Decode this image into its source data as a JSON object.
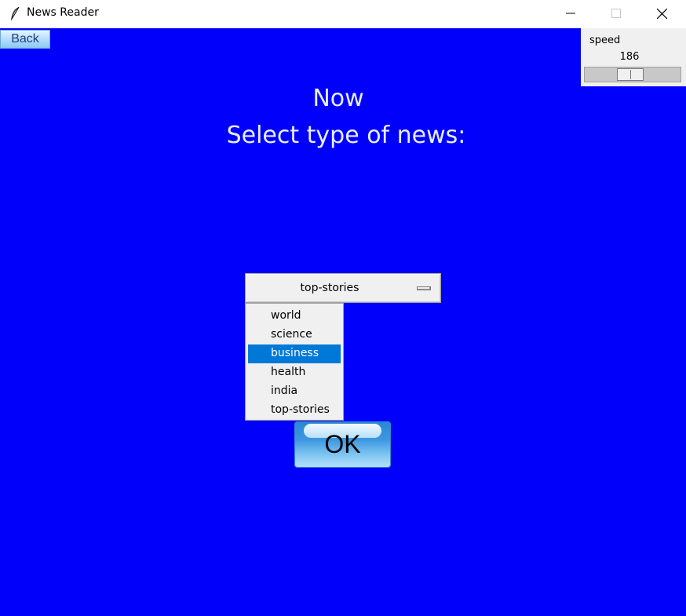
{
  "window": {
    "title": "News Reader",
    "icon": "feather-icon"
  },
  "toolbar": {
    "back_label": "Back"
  },
  "speed": {
    "label": "speed",
    "value": "186",
    "slider_fraction": 0.47
  },
  "headings": {
    "line1": "Now",
    "line2": "Select type of news:"
  },
  "news_type": {
    "selected_value": "top-stories",
    "options": [
      "world",
      "science",
      "business",
      "health",
      "india",
      "top-stories"
    ],
    "highlighted_option": "business"
  },
  "ok_button": {
    "label": "OK"
  },
  "colors": {
    "background": "#0000fb",
    "highlight": "#0078d7",
    "heading_text": "#e8eeff"
  }
}
